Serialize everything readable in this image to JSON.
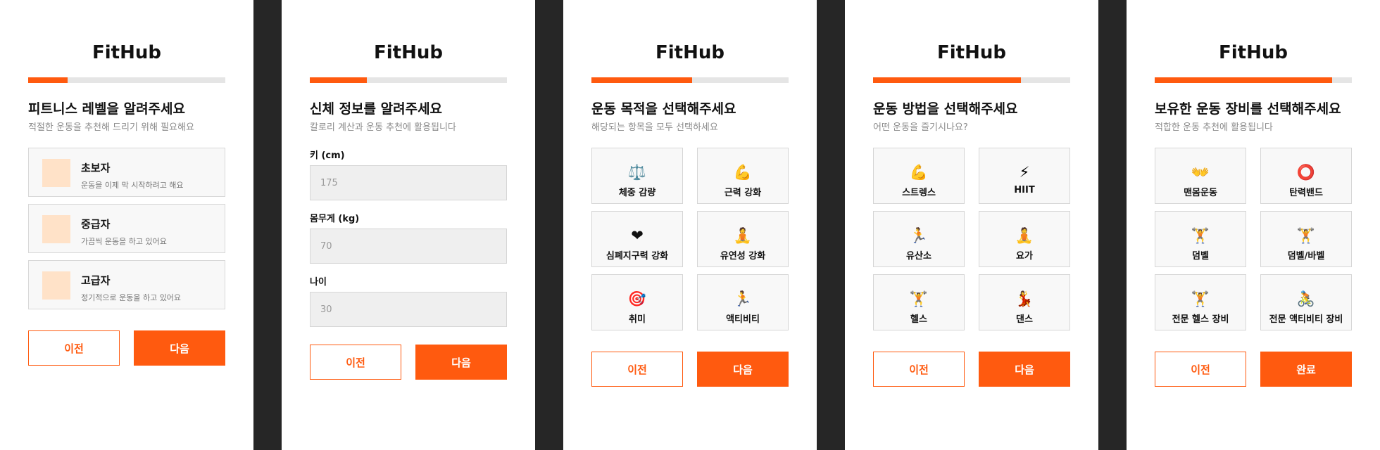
{
  "app": {
    "logo": "FitHub"
  },
  "colors": {
    "accent": "#ff5a0f",
    "panel_bg": "#ffffff",
    "gutter": "#262626"
  },
  "screens": [
    {
      "progress": 0.2,
      "title": "피트니스 레벨을 알려주세요",
      "subtitle": "적절한 운동을 추천해 드리기 위해 필요해요",
      "levels": [
        {
          "name": "초보자",
          "desc": "운동을 이제 막 시작하려고 해요"
        },
        {
          "name": "중급자",
          "desc": "가끔씩 운동을 하고 있어요"
        },
        {
          "name": "고급자",
          "desc": "정기적으로 운동을 하고 있어요"
        }
      ],
      "prev_label": "이전",
      "next_label": "다음"
    },
    {
      "progress": 0.29,
      "title": "신체 정보를 알려주세요",
      "subtitle": "칼로리 계산과 운동 추천에 활용됩니다",
      "fields": [
        {
          "label": "키 (cm)",
          "placeholder": "175"
        },
        {
          "label": "몸무게 (kg)",
          "placeholder": "70"
        },
        {
          "label": "나이",
          "placeholder": "30"
        }
      ],
      "prev_label": "이전",
      "next_label": "다음"
    },
    {
      "progress": 0.51,
      "title": "운동 목적을 선택해주세요",
      "subtitle": "해당되는 항목을 모두 선택하세요",
      "options": [
        {
          "icon": "⚖️",
          "icon_name": "scale-icon",
          "label": "체중 감량"
        },
        {
          "icon": "💪",
          "icon_name": "flexed-biceps-icon",
          "label": "근력 강화"
        },
        {
          "icon": "❤",
          "icon_name": "heart-icon",
          "label": "심폐지구력 강화"
        },
        {
          "icon": "🧘",
          "icon_name": "meditation-icon",
          "label": "유연성 강화"
        },
        {
          "icon": "🎯",
          "icon_name": "target-icon",
          "label": "취미"
        },
        {
          "icon": "🏃",
          "icon_name": "running-icon",
          "label": "액티비티"
        }
      ],
      "prev_label": "이전",
      "next_label": "다음"
    },
    {
      "progress": 0.75,
      "title": "운동 방법을 선택해주세요",
      "subtitle": "어떤 운동을 즐기시나요?",
      "options": [
        {
          "icon": "💪",
          "icon_name": "flexed-biceps-icon",
          "label": "스트렝스"
        },
        {
          "icon": "⚡",
          "icon_name": "lightning-icon",
          "label": "HIIT"
        },
        {
          "icon": "🏃",
          "icon_name": "running-icon",
          "label": "유산소"
        },
        {
          "icon": "🧘",
          "icon_name": "meditation-icon",
          "label": "요가"
        },
        {
          "icon": "🏋️",
          "icon_name": "weightlifter-icon",
          "label": "헬스"
        },
        {
          "icon": "💃",
          "icon_name": "dancer-icon",
          "label": "댄스"
        }
      ],
      "prev_label": "이전",
      "next_label": "다음"
    },
    {
      "progress": 0.9,
      "title": "보유한 운동 장비를 선택해주세요",
      "subtitle": "적합한 운동 추천에 활용됩니다",
      "options": [
        {
          "icon": "👐",
          "icon_name": "open-hands-icon",
          "label": "맨몸운동"
        },
        {
          "icon": "⭕",
          "icon_name": "circle-icon",
          "label": "탄력밴드"
        },
        {
          "icon": "🏋️",
          "icon_name": "weightlifter-icon",
          "label": "덤벨"
        },
        {
          "icon": "🏋️",
          "icon_name": "weightlifter-icon",
          "label": "덤벨/바벨"
        },
        {
          "icon": "🏋️",
          "icon_name": "weightlifter-icon",
          "label": "전문 헬스 장비"
        },
        {
          "icon": "🚴",
          "icon_name": "cyclist-icon",
          "label": "전문 액티비티 장비"
        }
      ],
      "prev_label": "이전",
      "next_label": "완료"
    }
  ]
}
